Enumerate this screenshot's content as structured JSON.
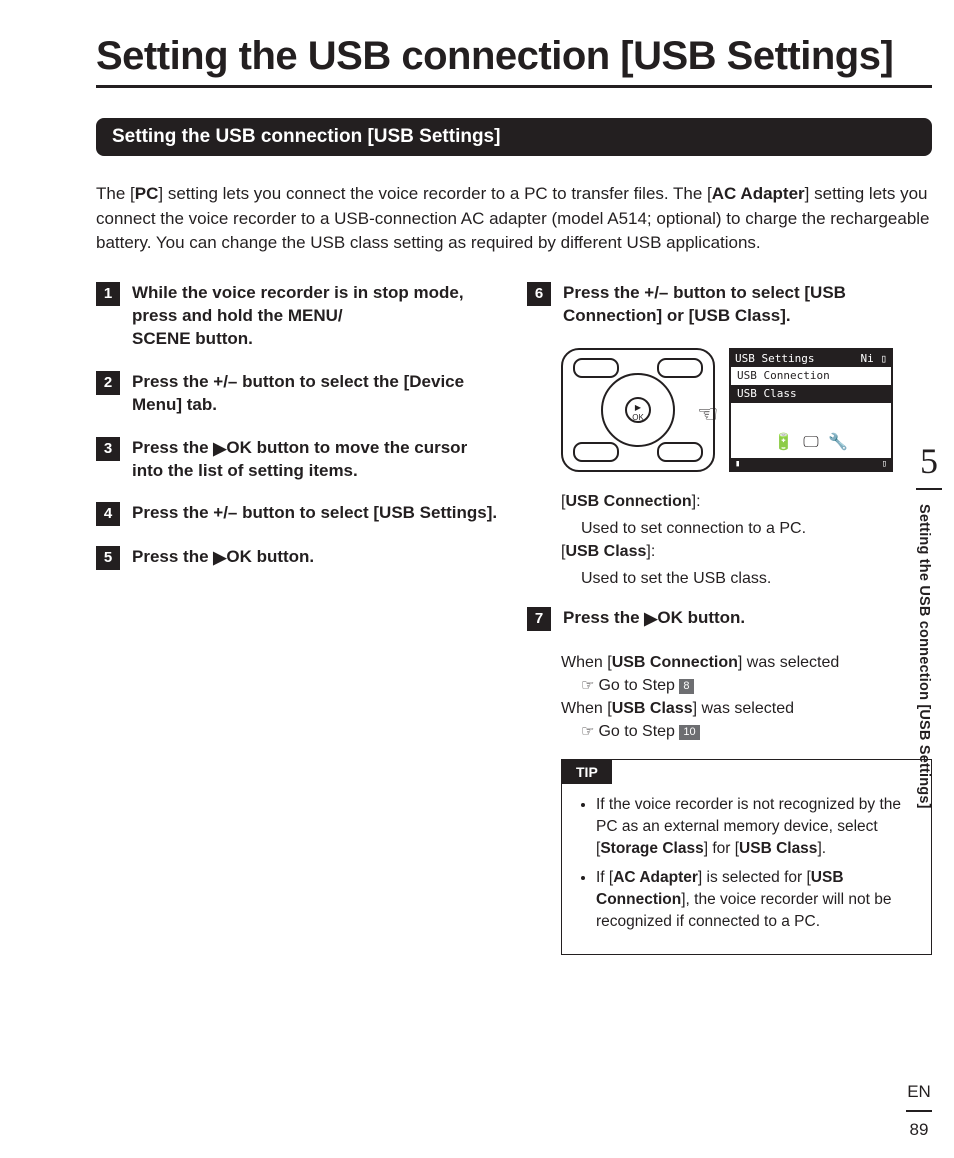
{
  "title": "Setting the USB connection [USB Settings]",
  "section_bar": "Setting the USB connection [USB Settings]",
  "intro": {
    "t1": "The [",
    "b1": "PC",
    "t2": "] setting lets you connect the voice recorder to a PC to transfer files. The [",
    "b2": "AC Adapter",
    "t3": "] setting lets you connect the voice recorder to a USB-connection AC adapter (model A514; optional) to charge the rechargeable battery. You can change the USB class setting as required by different USB applications."
  },
  "steps_left": [
    {
      "n": "1",
      "html": "While the voice recorder is in stop mode, press and hold the <b>MENU/<br>SCENE</b> button."
    },
    {
      "n": "2",
      "html": "Press the <b>+/–</b> button to select the [<b>Device Menu</b>] tab."
    },
    {
      "n": "3",
      "html": "Press the <span class='play'>▶</span><b>OK</b> button to move the cursor into the list of setting items."
    },
    {
      "n": "4",
      "html": "Press the <b>+/–</b> button to select [<b>USB Settings</b>]."
    },
    {
      "n": "5",
      "html": "Press the <span class='play'>▶</span><b>OK</b> button."
    }
  ],
  "steps_right": [
    {
      "n": "6",
      "html": "Press the <b>+/–</b> button to select [<b>USB Connection</b>] or [<b>USB Class</b>]."
    }
  ],
  "lcd": {
    "title": "USB Settings",
    "batt": "Ni",
    "row1": "USB Connection",
    "row2": "USB Class"
  },
  "desc6": {
    "a_label": "USB Connection",
    "a_text": "Used to set connection to a PC.",
    "b_label": "USB Class",
    "b_text": "Used to set the USB class."
  },
  "step7": {
    "n": "7",
    "html": "Press the <span class='play'>▶</span><b>OK</b> button."
  },
  "after7": {
    "w1a": "When [",
    "w1b": "USB Connection",
    "w1c": "] was selected",
    "g1": "Go to Step",
    "g1n": "8",
    "w2a": "When [",
    "w2b": "USB Class",
    "w2c": "] was selected",
    "g2": "Go to Step",
    "g2n": "10"
  },
  "tip": {
    "label": "TIP",
    "items": [
      "If the voice recorder is not recognized by the PC as an external memory device, select [<b>Storage Class</b>] for [<b>USB Class</b>].",
      "If [<b>AC Adapter</b>] is selected for [<b>USB Connection</b>], the voice recorder will not be recognized if connected to a PC."
    ]
  },
  "side": {
    "num": "5",
    "text": "Setting the USB connection [USB Settings]"
  },
  "footer": {
    "lang": "EN",
    "page": "89"
  }
}
